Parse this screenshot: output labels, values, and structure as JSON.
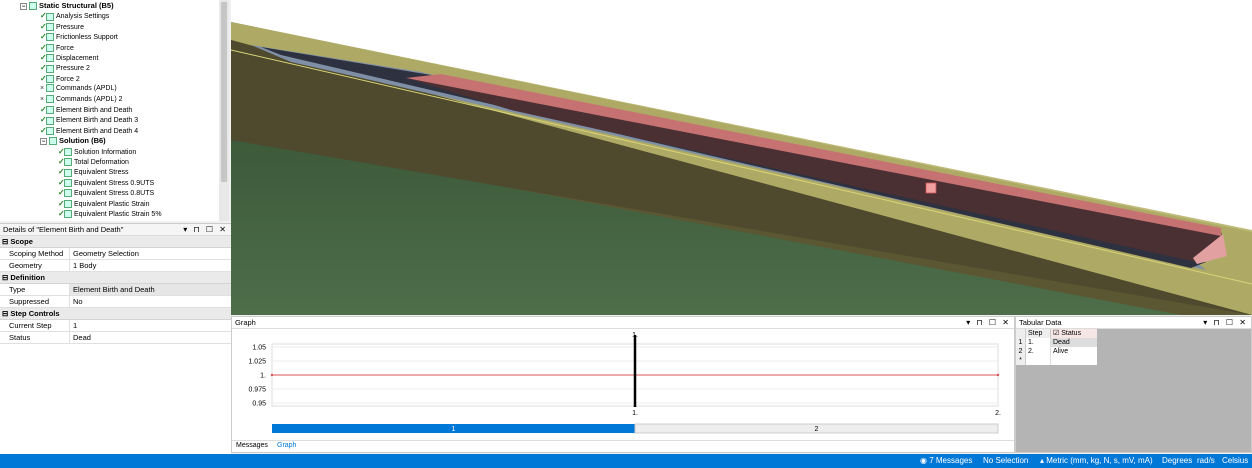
{
  "tree": {
    "items": [
      {
        "label": "Static Structural (B5)",
        "level": 0,
        "bold": true,
        "icon": "static-structural-icon",
        "mark": "exp"
      },
      {
        "label": "Analysis Settings",
        "level": 1,
        "icon": "analysis-settings-icon",
        "mark": "check"
      },
      {
        "label": "Pressure",
        "level": 1,
        "icon": "pressure-icon",
        "mark": "check"
      },
      {
        "label": "Frictionless Support",
        "level": 1,
        "icon": "support-icon",
        "mark": "check"
      },
      {
        "label": "Force",
        "level": 1,
        "icon": "force-icon",
        "mark": "check"
      },
      {
        "label": "Displacement",
        "level": 1,
        "icon": "displacement-icon",
        "mark": "check"
      },
      {
        "label": "Pressure 2",
        "level": 1,
        "icon": "pressure-icon",
        "mark": "check"
      },
      {
        "label": "Force 2",
        "level": 1,
        "icon": "force-icon",
        "mark": "check"
      },
      {
        "label": "Commands (APDL)",
        "level": 1,
        "icon": "commands-icon",
        "mark": "x"
      },
      {
        "label": "Commands (APDL) 2",
        "level": 1,
        "icon": "commands-icon",
        "mark": "x"
      },
      {
        "label": "Element Birth and Death",
        "level": 1,
        "icon": "birth-death-icon",
        "mark": "check"
      },
      {
        "label": "Element Birth and Death 3",
        "level": 1,
        "icon": "birth-death-icon",
        "mark": "check"
      },
      {
        "label": "Element Birth and Death 4",
        "level": 1,
        "icon": "birth-death-icon",
        "mark": "check"
      },
      {
        "label": "Solution (B6)",
        "level": 1,
        "bold": true,
        "icon": "solution-icon",
        "mark": "exp"
      },
      {
        "label": "Solution Information",
        "level": 2,
        "icon": "solution-info-icon",
        "mark": "check"
      },
      {
        "label": "Total Deformation",
        "level": 2,
        "icon": "result-icon",
        "mark": "check"
      },
      {
        "label": "Equivalent Stress",
        "level": 2,
        "icon": "result-icon",
        "mark": "check"
      },
      {
        "label": "Equivalent Stress 0.9UTS",
        "level": 2,
        "icon": "result-icon",
        "mark": "check"
      },
      {
        "label": "Equivalent Stress 0.8UTS",
        "level": 2,
        "icon": "result-icon",
        "mark": "check"
      },
      {
        "label": "Equivalent Plastic Strain",
        "level": 2,
        "icon": "result-icon",
        "mark": "check"
      },
      {
        "label": "Equivalent Plastic Strain 5%",
        "level": 2,
        "icon": "result-icon",
        "mark": "check"
      }
    ]
  },
  "details": {
    "title": "Details of \"Element Birth and Death\"",
    "sections": [
      {
        "name": "Scope",
        "rows": [
          {
            "key": "Scoping Method",
            "value": "Geometry Selection"
          },
          {
            "key": "Geometry",
            "value": "1 Body"
          }
        ]
      },
      {
        "name": "Definition",
        "rows": [
          {
            "key": "Type",
            "value": "Element Birth and Death",
            "highlight": true
          },
          {
            "key": "Suppressed",
            "value": "No"
          }
        ]
      },
      {
        "name": "Step Controls",
        "rows": [
          {
            "key": "Current Step",
            "value": "1"
          },
          {
            "key": "Status",
            "value": "Dead"
          }
        ]
      }
    ]
  },
  "graph": {
    "title": "Graph",
    "step_labels": [
      "1",
      "2"
    ],
    "tabs": [
      "Messages",
      "Graph"
    ],
    "active_tab": "Graph"
  },
  "chart_data": {
    "type": "line",
    "x": [
      0,
      1,
      2
    ],
    "series": [
      {
        "values": [
          1,
          1,
          1
        ]
      }
    ],
    "ylim": [
      0.95,
      1.05
    ],
    "yticks": [
      "1.05",
      "1.025",
      "1.",
      "0.975",
      "0.95"
    ],
    "xticks": [
      "1.",
      "2."
    ],
    "cursor_label": "1.",
    "line_color": "#d9534f"
  },
  "tabular": {
    "title": "Tabular Data",
    "headers": [
      "Step",
      "Status"
    ],
    "rows": [
      {
        "num": "1",
        "step": "1.",
        "status": "Dead"
      },
      {
        "num": "2",
        "step": "2.",
        "status": "Alive"
      },
      {
        "num": "*",
        "step": "",
        "status": ""
      }
    ]
  },
  "statusbar": {
    "messages": "7 Messages",
    "selection": "No Selection",
    "units": "Metric (mm, kg, N, s, mV, mA)",
    "angle": "Degrees",
    "rotation": "rad/s",
    "temperature": "Celsius"
  },
  "colors": {
    "accent": "#0078d7",
    "terrain_dark": "#3d5a3a",
    "soil": "#5a5a32",
    "pipe": "#b06060"
  }
}
